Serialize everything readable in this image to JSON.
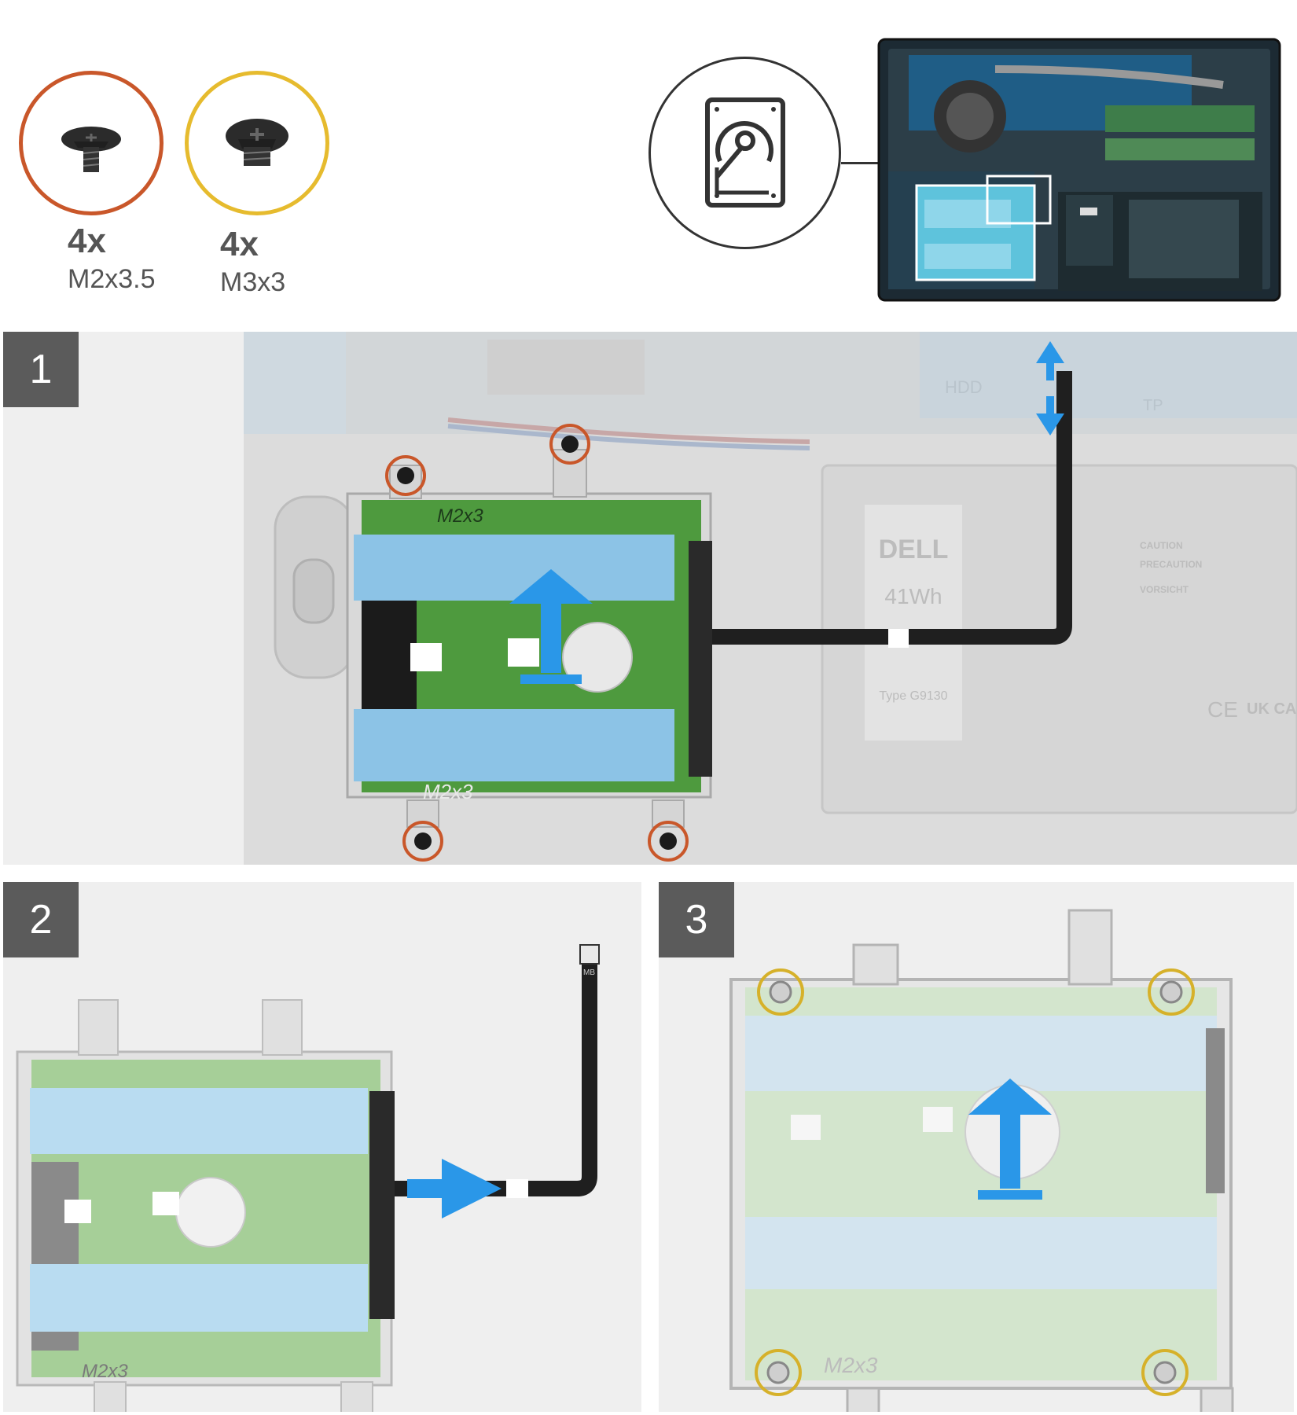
{
  "screws": [
    {
      "count": "4x",
      "size": "M2x3.5",
      "ring_color": "#c9572a"
    },
    {
      "count": "4x",
      "size": "M3x3",
      "ring_color": "#e6bb2e"
    }
  ],
  "overview": {
    "component_icon": "hard-drive-icon",
    "highlight_color": "#ffffff",
    "board_labels": {
      "hdd": "HDD",
      "tp": "TP"
    }
  },
  "steps": [
    {
      "number": "1"
    },
    {
      "number": "2"
    },
    {
      "number": "3"
    }
  ],
  "drive_labels": {
    "screw_mark_top": "M2x3",
    "screw_mark_bottom": "M2x3",
    "fpc_tag": "MB"
  },
  "battery_labels": {
    "brand": "DELL",
    "capacity": "41Wh",
    "type": "Type G9130",
    "caution": "CAUTION",
    "precaution": "PRECAUTION",
    "vorsicht": "VORSICHT",
    "ce": "CE",
    "ukca": "UK CA"
  },
  "colors": {
    "arrow": "#2a97e8",
    "foam": "#8cc3e6",
    "pcb": "#5aa047",
    "badge": "#5b5b5b"
  }
}
